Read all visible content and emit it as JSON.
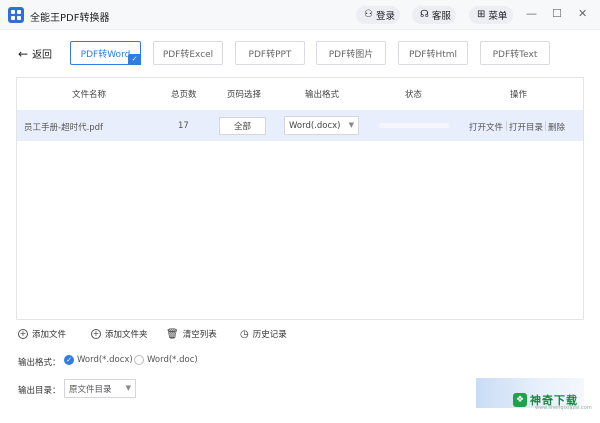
{
  "window": {
    "title": "全能王PDF转换器",
    "login": "登录",
    "service": "客服",
    "menu": "菜单",
    "minimize": "—",
    "maximize": "☐",
    "close": "✕"
  },
  "nav": {
    "back": "返回",
    "tabs": [
      {
        "label": "PDF转Word",
        "active": true
      },
      {
        "label": "PDF转Excel",
        "active": false
      },
      {
        "label": "PDF转PPT",
        "active": false
      },
      {
        "label": "PDF转图片",
        "active": false
      },
      {
        "label": "PDF转Html",
        "active": false
      },
      {
        "label": "PDF转Text",
        "active": false
      }
    ]
  },
  "table": {
    "headers": [
      "文件名称",
      "总页数",
      "页码选择",
      "输出格式",
      "状态",
      "操作"
    ],
    "rows": [
      {
        "name": "员工手册-超时代.pdf",
        "pages": "17",
        "page_select": "全部",
        "format": "Word(.docx)",
        "actions": [
          "打开文件",
          "打开目录",
          "删除"
        ]
      }
    ]
  },
  "actions": {
    "add_file": "添加文件",
    "add_folder": "添加文件夹",
    "clear_list": "清空列表",
    "history": "历史记录"
  },
  "output": {
    "format_label": "输出格式：",
    "options": [
      "Word(*.docx)",
      "Word(*.doc)"
    ],
    "selected": "Word(*.docx)",
    "dir_label": "输出目录：",
    "dir_value": "原文件目录"
  },
  "watermark": {
    "brand": "神奇下载",
    "url": "www.shenqixiazai.com"
  },
  "colors": {
    "accent": "#2f7de1",
    "row_highlight": "#e8eefb",
    "brand_green": "#17883d"
  }
}
